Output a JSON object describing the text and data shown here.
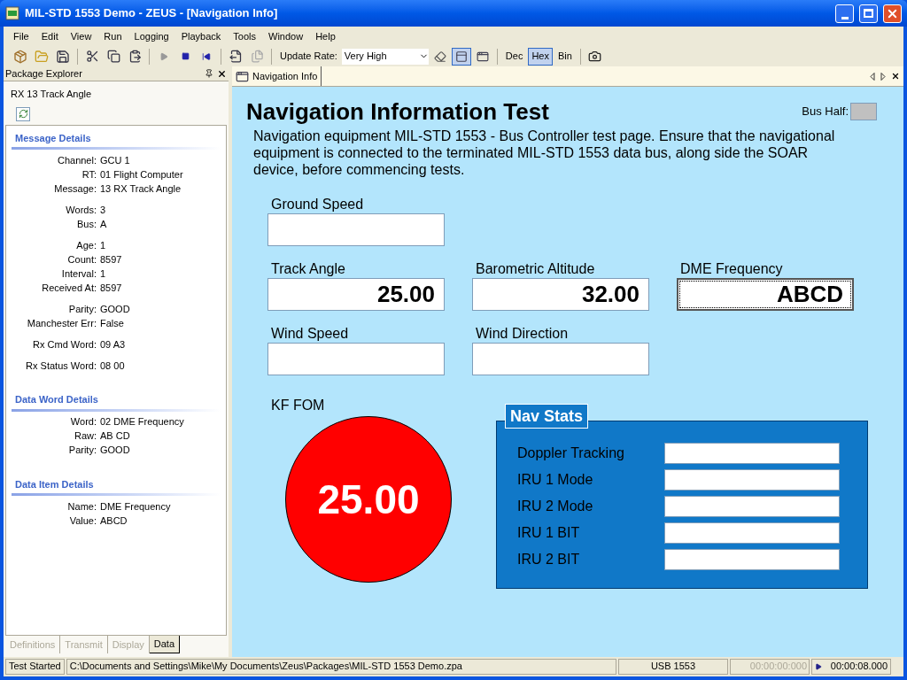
{
  "window": {
    "title": "MIL-STD 1553 Demo - ZEUS - [Navigation Info]"
  },
  "menu": [
    "File",
    "Edit",
    "View",
    "Run",
    "Logging",
    "Playback",
    "Tools",
    "Window",
    "Help"
  ],
  "toolbar": {
    "update_rate_label": "Update Rate:",
    "update_rate": "Very High",
    "formats": [
      {
        "label": "Dec",
        "selected": false
      },
      {
        "label": "Hex",
        "selected": true
      },
      {
        "label": "Bin",
        "selected": false
      }
    ]
  },
  "package_explorer": {
    "title": "Package Explorer",
    "item": "RX 13 Track Angle",
    "sections": [
      {
        "title": "Message Details",
        "groups": [
          [
            {
              "label": "Channel:",
              "value": "GCU 1"
            },
            {
              "label": "RT:",
              "value": "01 Flight Computer"
            },
            {
              "label": "Message:",
              "value": "13 RX Track Angle"
            }
          ],
          [
            {
              "label": "Words:",
              "value": "3"
            },
            {
              "label": "Bus:",
              "value": "A"
            }
          ],
          [
            {
              "label": "Age:",
              "value": "1"
            },
            {
              "label": "Count:",
              "value": "8597"
            },
            {
              "label": "Interval:",
              "value": "1"
            },
            {
              "label": "Received At:",
              "value": "8597"
            }
          ],
          [
            {
              "label": "Parity:",
              "value": "GOOD"
            },
            {
              "label": "Manchester Err:",
              "value": "False"
            }
          ],
          [
            {
              "label": "Rx Cmd Word:",
              "value": "09 A3"
            }
          ],
          [
            {
              "label": "Rx Status Word:",
              "value": "08 00"
            }
          ]
        ]
      },
      {
        "title": "Data Word Details",
        "groups": [
          [
            {
              "label": "Word:",
              "value": "02 DME Frequency"
            },
            {
              "label": "Raw:",
              "value": "AB CD"
            },
            {
              "label": "Parity:",
              "value": "GOOD"
            }
          ]
        ]
      },
      {
        "title": "Data Item Details",
        "groups": [
          [
            {
              "label": "Name:",
              "value": "DME Frequency"
            },
            {
              "label": "Value:",
              "value": "ABCD"
            }
          ]
        ]
      }
    ],
    "tabs": [
      {
        "label": "Definitions",
        "selected": false
      },
      {
        "label": "Transmit",
        "selected": false
      },
      {
        "label": "Display",
        "selected": false
      },
      {
        "label": "Data",
        "selected": true
      }
    ]
  },
  "document_tab": {
    "label": "Navigation Info"
  },
  "page": {
    "title": "Navigation Information Test",
    "bus_half_label": "Bus Half:",
    "description": "Navigation equipment MIL-STD 1553 - Bus Controller test page. Ensure that the navigational equipment is connected to the terminated MIL-STD 1553 data bus, along side the SOAR device, before commencing tests.",
    "field_rows": [
      [
        {
          "label": "Ground Speed",
          "focused": false
        }
      ],
      [
        {
          "label": "Track Angle",
          "value": "25.00",
          "focused": false
        },
        {
          "label": "Barometric Altitude",
          "value": "32.00",
          "focused": false
        },
        {
          "label": "DME Frequency",
          "value": "ABCD",
          "focused": true
        }
      ],
      [
        {
          "label": "Wind Speed",
          "focused": false
        },
        {
          "label": "Wind Direction",
          "focused": false
        }
      ]
    ],
    "kf_fom": {
      "label": "KF FOM",
      "value": "25.00"
    },
    "nav_stats": {
      "title": "Nav Stats",
      "rows": [
        {
          "label": "Doppler Tracking"
        },
        {
          "label": "IRU 1 Mode"
        },
        {
          "label": "IRU 2 Mode"
        },
        {
          "label": "IRU 1 BIT"
        },
        {
          "label": "IRU 2 BIT"
        }
      ]
    }
  },
  "status_bar": {
    "message": "Test Started",
    "path": "C:\\Documents and Settings\\Mike\\My Documents\\Zeus\\Packages\\MIL-STD 1553 Demo.zpa",
    "device": "USB 1553",
    "start_time": "00:00:00:000",
    "time": "00:00:08.000"
  }
}
